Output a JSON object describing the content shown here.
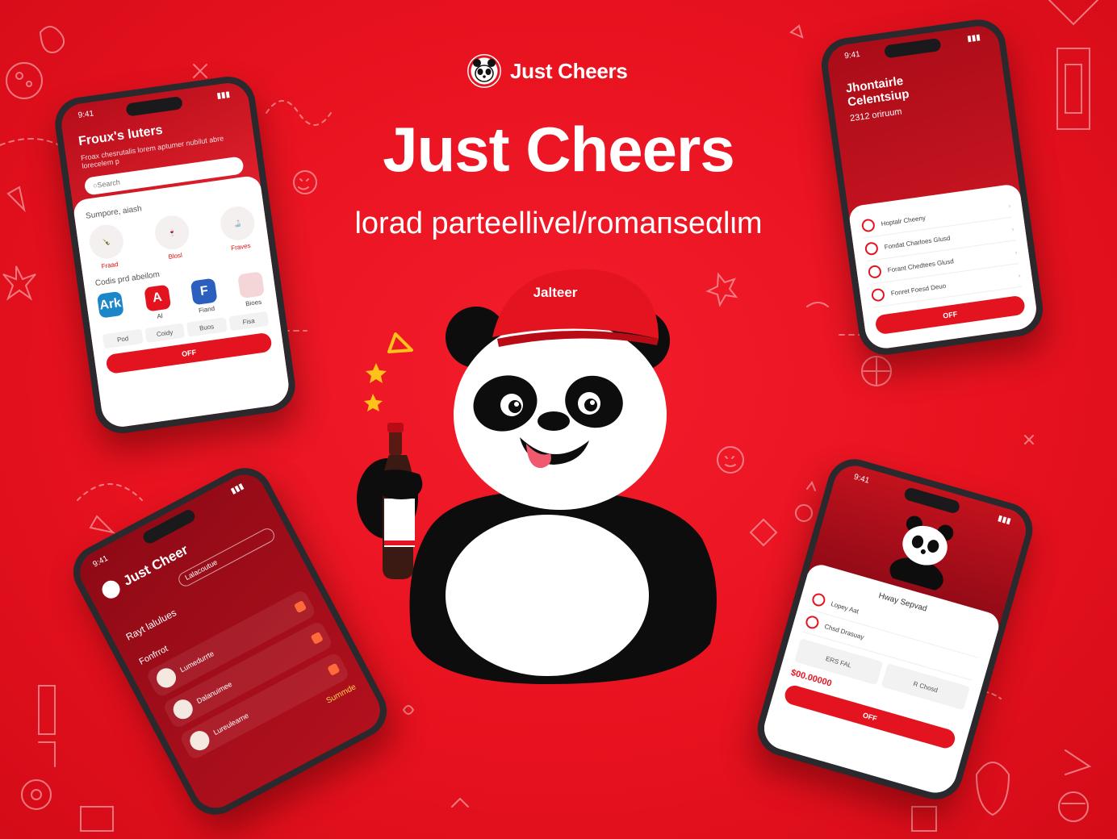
{
  "brand": {
    "logo_label": "Just Cheers"
  },
  "hero": {
    "title": "Just Cheers",
    "subtitle": "lorad parteellivel/romaпseαlιm"
  },
  "mascot": {
    "cap_text": "Jalteer"
  },
  "phones": {
    "top_left": {
      "status_time": "9:41",
      "title": "Froux's luters",
      "desc": "Froax chesrutalis lorem aptumer nubilut abre lorecelem p",
      "search_placeholder": "Search",
      "section_products": "Sumpore, aiash",
      "products": [
        "Fraad",
        "Blosl",
        "Fraves"
      ],
      "section_payment": "Codis prd abeilom",
      "payments": [
        "Ark",
        "A",
        "F",
        ""
      ],
      "payment_labels": [
        "",
        "Al",
        "Fiand",
        "Bioes"
      ],
      "chips": [
        "Pod",
        "Coidy",
        "Buos",
        "Fisa"
      ],
      "cta": "OFF"
    },
    "top_right": {
      "status_time": "9:41",
      "title": "Jhontairle Celentsiup",
      "desc": "2312 oriruum",
      "rows": [
        "Hoptalr Cheeny",
        "Fondat Charloes Glusd",
        "Forant Chedtees Glusd",
        "Fonret Foesd Deuo"
      ],
      "cta": "OFF"
    },
    "bottom_left": {
      "status_time": "9:41",
      "title": "Just Cheer",
      "field": "Lalacoutue",
      "sub": "Rayt lalulues",
      "section": "Fonfrrot",
      "items": [
        "Lumedurrte",
        "Dalanuimee",
        "Lureulearne"
      ],
      "footer": "Summde"
    },
    "bottom_right": {
      "status_time": "9:41",
      "header": "Hway Sepvad",
      "rows": [
        "Lopey Aat",
        "Chsd Drasuay"
      ],
      "stats": [
        "ERS FAL",
        "R Chosd"
      ],
      "price": "$00.00000",
      "cta": "OFF"
    }
  },
  "colors": {
    "background": "#e8121f",
    "accent": "#e3141f",
    "dark_phone": "#2a2a2e",
    "panda_black": "#0d0d0d"
  },
  "icons": [
    "panda-logo-icon",
    "star-icon",
    "sparkle-icon",
    "beer-bottle-icon",
    "credit-card-icon"
  ]
}
